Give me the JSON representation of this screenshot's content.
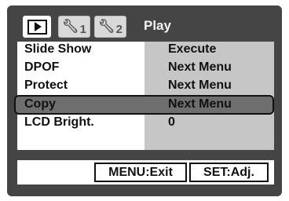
{
  "header": {
    "title": "Play",
    "tabs": [
      {
        "id": "play",
        "icon": "play-icon"
      },
      {
        "id": "setup1",
        "icon": "wrench-icon",
        "number": "1"
      },
      {
        "id": "setup2",
        "icon": "wrench-icon",
        "number": "2"
      }
    ]
  },
  "menu": {
    "items": [
      {
        "label": "Slide Show",
        "value": "Execute"
      },
      {
        "label": "DPOF",
        "value": "Next Menu"
      },
      {
        "label": "Protect",
        "value": "Next Menu"
      },
      {
        "label": "Copy",
        "value": "Next Menu"
      },
      {
        "label": "LCD Bright.",
        "value": "0"
      }
    ],
    "selected_index": 3
  },
  "footer": {
    "exit_label": "MENU:Exit",
    "adj_label": "SET:Adj."
  },
  "colors": {
    "screen": "#454545",
    "panel": "#ffffff",
    "value_column": "#c6c6c6",
    "selection": "#6e6e6e"
  }
}
